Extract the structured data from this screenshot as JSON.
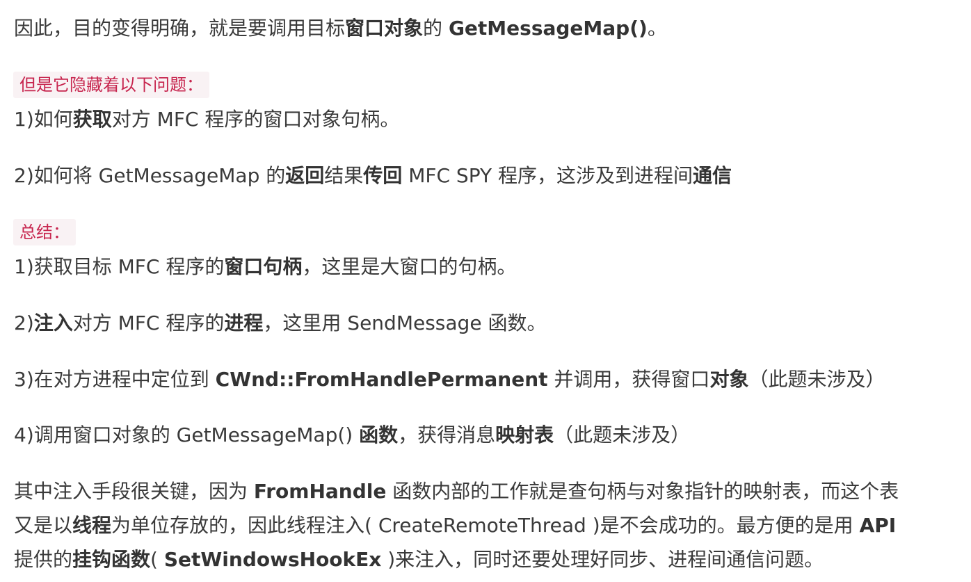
{
  "intro": {
    "t1": "因此，目的变得明确，就是要调用目标",
    "b1": "窗口对象",
    "t2": "的 ",
    "b2": "GetMessageMap()",
    "t3": "。"
  },
  "problems": {
    "label": "但是它隐藏着以下问题：",
    "p1": {
      "t1": "1)如何",
      "b1": "获取",
      "t2": "对方 MFC 程序的窗口对象句柄。"
    },
    "p2": {
      "t1": "2)如何将 GetMessageMap 的",
      "b1": "返回",
      "t2": "结果",
      "b2": "传回",
      "t3": " MFC SPY 程序，这涉及到进程间",
      "b3": "通信"
    }
  },
  "summary": {
    "label": "总结：",
    "s1": {
      "t1": "1)获取目标 MFC 程序的",
      "b1": "窗口句柄",
      "t2": "，这里是大窗口的句柄。"
    },
    "s2": {
      "t1": "2)",
      "b1": "注入",
      "t2": "对方 MFC 程序的",
      "b2": "进程",
      "t3": "，这里用 SendMessage 函数。"
    },
    "s3": {
      "t1": "3)在对方进程中定位到 ",
      "b1": "CWnd::FromHandlePermanent",
      "t2": " 并调用，获得窗口",
      "b2": "对象",
      "t3": "（此题未涉及）"
    },
    "s4": {
      "t1": "4)调用窗口对象的 GetMessageMap() ",
      "b1": "函数",
      "t2": "，获得消息",
      "b2": "映射表",
      "t3": "（此题未涉及）"
    }
  },
  "closing": {
    "l1": {
      "t1": "其中注入手段很关键，因为 ",
      "b1": "FromHandle",
      "t2": " 函数内部的工作就是查句柄与对象指针的映射表，而这个表"
    },
    "l2": {
      "t1": "又是以",
      "b1": "线程",
      "t2": "为单位存放的，因此线程注入( CreateRemoteThread )是不会成功的。最方便的是用 ",
      "b2": "API"
    },
    "l3": {
      "t1": "提供的",
      "b1": "挂钩函数",
      "t2": "( ",
      "b2": "SetWindowsHookEx",
      "t3": " )来注入，同时还要处理好同步、进程间通信问题。"
    }
  }
}
